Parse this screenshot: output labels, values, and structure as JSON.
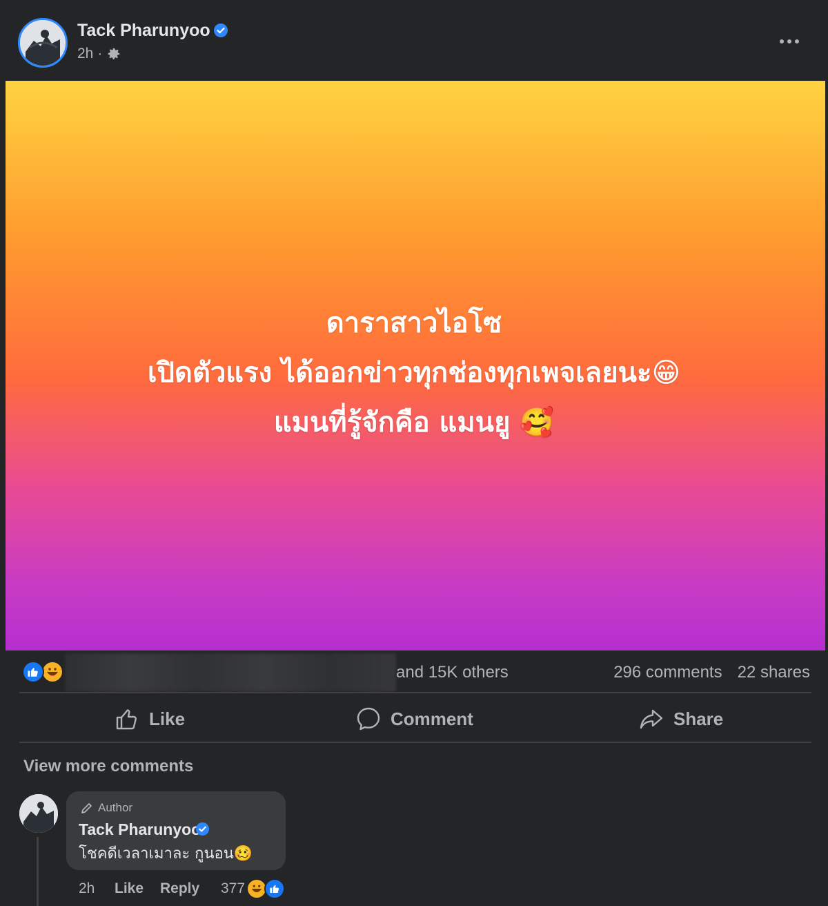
{
  "post": {
    "author": "Tack Pharunyoo",
    "time": "2h",
    "separator": "·",
    "audience_icon": "gear-icon",
    "more_icon": "more-options-icon",
    "text_lines": [
      "ดาราสาวไอโซ",
      "เปิดตัวแรง ได้ออกข่าวทุกช่องทุกเพจเลยนะ😁",
      "แมนที่รู้จักคือ แมนยู 🥰"
    ],
    "background_gradient": [
      "#ffd340",
      "#ff6b3d",
      "#b52fd0"
    ]
  },
  "stats": {
    "reaction_icons": [
      "like-icon",
      "haha-icon"
    ],
    "others_text": "and 15K others",
    "comments_text": "296 comments",
    "shares_text": "22 shares"
  },
  "actions": {
    "like": "Like",
    "comment": "Comment",
    "share": "Share"
  },
  "comments": {
    "view_more": "View more comments",
    "items": [
      {
        "badge": "Author",
        "name": "Tack Pharunyoo",
        "text": "โชคดีเวลาเมาละ กูนอน🥴",
        "time": "2h",
        "like_label": "Like",
        "reply_label": "Reply",
        "reaction_count": "377"
      }
    ]
  },
  "colors": {
    "card_bg": "#242526",
    "text_primary": "#e4e6eb",
    "text_secondary": "#b0b3b8",
    "accent_blue": "#1877f2",
    "divider": "#3e4042"
  }
}
